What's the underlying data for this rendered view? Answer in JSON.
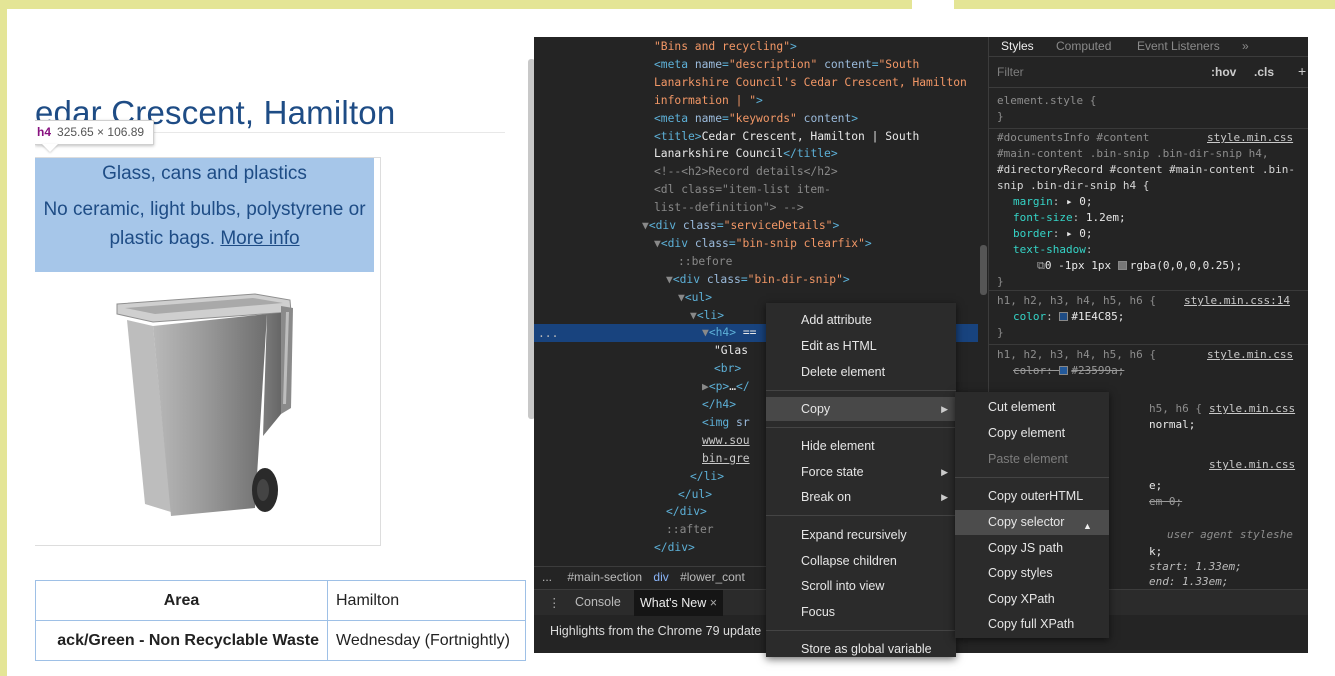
{
  "webpage": {
    "title": "edar Crescent, Hamilton",
    "tooltip": {
      "tag": "h4",
      "size": "325.65 × 106.89"
    },
    "bin_heading": "Glass, cans and plastics",
    "bin_note": "No ceramic, light bulbs, polystyrene or plastic bags.",
    "more_info": "More info",
    "table": [
      {
        "label": "Area",
        "value": "Hamilton"
      },
      {
        "label": "ack/Green - Non Recyclable Waste",
        "value": "Wednesday (Fortnightly)"
      }
    ]
  },
  "devtools": {
    "elements_lines": [
      {
        "indent": 0,
        "parts": [
          [
            "val",
            "\"Bins and recycling\""
          ],
          [
            "tag",
            ">"
          ]
        ]
      },
      {
        "indent": 0,
        "parts": [
          [
            "tag",
            "<meta "
          ],
          [
            "attr",
            "name"
          ],
          [
            "tag",
            "="
          ],
          [
            "val",
            "\"description\""
          ],
          [
            "attr",
            " content"
          ],
          [
            "tag",
            "="
          ],
          [
            "val",
            "\"South"
          ]
        ]
      },
      {
        "indent": 0,
        "parts": [
          [
            "val",
            "Lanarkshire Council's Cedar Crescent, Hamilton"
          ]
        ]
      },
      {
        "indent": 0,
        "parts": [
          [
            "val",
            "information | \""
          ],
          [
            "tag",
            ">"
          ]
        ]
      },
      {
        "indent": 0,
        "parts": [
          [
            "tag",
            "<meta "
          ],
          [
            "attr",
            "name"
          ],
          [
            "tag",
            "="
          ],
          [
            "val",
            "\"keywords\""
          ],
          [
            "attr",
            " content"
          ],
          [
            "tag",
            ">"
          ]
        ]
      },
      {
        "indent": 0,
        "parts": [
          [
            "tag",
            "<title>"
          ],
          [
            "txt",
            "Cedar Crescent, Hamilton | South"
          ]
        ]
      },
      {
        "indent": 0,
        "parts": [
          [
            "txt",
            "Lanarkshire Council"
          ],
          [
            "tag",
            "</title>"
          ]
        ]
      },
      {
        "indent": 0,
        "parts": [
          [
            "com",
            "<!--<h2>Record details</h2>"
          ]
        ]
      },
      {
        "indent": 0,
        "parts": [
          [
            "com",
            "               <dl class=\"item-list item-"
          ]
        ]
      },
      {
        "indent": 0,
        "parts": [
          [
            "com",
            "list--definition\"> -->"
          ]
        ]
      },
      {
        "indent": -1,
        "parts": [
          [
            "com",
            "▼"
          ],
          [
            "tag",
            "<div "
          ],
          [
            "attr",
            "class"
          ],
          [
            "tag",
            "="
          ],
          [
            "val",
            "\"serviceDetails\""
          ],
          [
            "tag",
            ">"
          ]
        ]
      },
      {
        "indent": 0,
        "parts": [
          [
            "com",
            "▼"
          ],
          [
            "tag",
            "<div "
          ],
          [
            "attr",
            "class"
          ],
          [
            "tag",
            "="
          ],
          [
            "val",
            "\"bin-snip clearfix\""
          ],
          [
            "tag",
            ">"
          ]
        ]
      },
      {
        "indent": 2,
        "parts": [
          [
            "com",
            "::before"
          ]
        ]
      },
      {
        "indent": 1,
        "parts": [
          [
            "com",
            "▼"
          ],
          [
            "tag",
            "<div "
          ],
          [
            "attr",
            "class"
          ],
          [
            "tag",
            "="
          ],
          [
            "val",
            "\"bin-dir-snip\""
          ],
          [
            "tag",
            ">"
          ]
        ]
      },
      {
        "indent": 2,
        "parts": [
          [
            "com",
            "▼"
          ],
          [
            "tag",
            "<ul>"
          ]
        ]
      },
      {
        "indent": 3,
        "parts": [
          [
            "com",
            "▼"
          ],
          [
            "tag",
            "<li>"
          ]
        ]
      },
      {
        "indent": 4,
        "parts": [
          [
            "com",
            "▼"
          ],
          [
            "tag",
            "<h4>"
          ],
          [
            "txt",
            " =="
          ]
        ]
      },
      {
        "indent": 5,
        "parts": [
          [
            "txt",
            "\"Glas"
          ]
        ]
      },
      {
        "indent": 5,
        "parts": [
          [
            "tag",
            "<br>"
          ]
        ]
      },
      {
        "indent": 4,
        "parts": [
          [
            "com",
            "▶"
          ],
          [
            "tag",
            "<p>"
          ],
          [
            "txt",
            "…"
          ],
          [
            "tag",
            "</"
          ]
        ]
      },
      {
        "indent": 4,
        "parts": [
          [
            "tag",
            "</h4>"
          ]
        ]
      },
      {
        "indent": 4,
        "parts": [
          [
            "tag",
            "<img "
          ],
          [
            "attr",
            "sr"
          ]
        ]
      },
      {
        "indent": 4,
        "parts": [
          [
            "link",
            "www.sou"
          ]
        ]
      },
      {
        "indent": 4,
        "parts": [
          [
            "link",
            "bin-gre"
          ]
        ]
      },
      {
        "indent": 3,
        "parts": [
          [
            "tag",
            "</li>"
          ]
        ]
      },
      {
        "indent": 2,
        "parts": [
          [
            "tag",
            "</ul>"
          ]
        ]
      },
      {
        "indent": 1,
        "parts": [
          [
            "tag",
            "</div>"
          ]
        ]
      },
      {
        "indent": 1,
        "parts": [
          [
            "com",
            "::after"
          ]
        ]
      },
      {
        "indent": 0,
        "parts": [
          [
            "tag",
            "</div>"
          ]
        ]
      }
    ],
    "breadcrumb": {
      "ellipsis": "...",
      "main_section": "#main-section",
      "div": "div",
      "lower": "#lower_cont"
    },
    "drawer": {
      "console": "Console",
      "whats_new": "What's New",
      "close": "×",
      "highlights": "Highlights from the Chrome 79 update"
    },
    "styles": {
      "tabs": [
        "Styles",
        "Computed",
        "Event Listeners",
        "»"
      ],
      "filter_placeholder": "Filter",
      "hov": ":hov",
      "cls": ".cls",
      "plus": "+",
      "element_style": "element.style {",
      "brace_close": "}",
      "rule1_sel1": "#documentsInfo #content",
      "rule1_link": "style.min.css",
      "rule1_sel2": "#main-content .bin-snip .bin-dir-snip h4,",
      "rule1_sel3": "#directoryRecord #content #main-content .bin-",
      "rule1_sel4": "snip .bin-dir-snip h4 {",
      "margin": [
        "margin",
        "▸ 0;"
      ],
      "font_size": [
        "font-size",
        "1.2em;"
      ],
      "border": [
        "border",
        "▸ 0;"
      ],
      "text_shadow": [
        "text-shadow",
        ""
      ],
      "text_shadow_val": "0 -1px 1px ",
      "text_shadow_color": "rgba(0,0,0,0.25);",
      "rule2_sel": "h1, h2, h3, h4, h5, h6 {",
      "rule2_link": "style.min.css:14",
      "rule2_color": [
        "color",
        "#1E4C85;"
      ],
      "rule3_sel": "h1, h2, h3, h4, h5, h6 {",
      "rule3_link": "style.min.css",
      "rule3_color": [
        "color",
        "#23599a;"
      ],
      "rule4_sel": "h5, h6 {",
      "rule4_link": "style.min.css",
      "rule4_val": "normal;",
      "rule5_link": "style.min.css",
      "rule5_a": "e;",
      "rule5_b": "em 0;",
      "ua": "user agent styleshe",
      "ua_semi": "k;",
      "ua_start": "start: 1.33em;",
      "ua_end": "end: 1.33em;",
      "colors": {
        "h1color": "#1E4C85",
        "h1color_old": "#23599a"
      }
    },
    "context_menu": {
      "items": [
        "Add attribute",
        "Edit as HTML",
        "Delete element",
        "Copy",
        "Hide element",
        "Force state",
        "Break on",
        "Expand recursively",
        "Collapse children",
        "Scroll into view",
        "Focus",
        "Store as global variable"
      ],
      "submenu": [
        "Cut element",
        "Copy element",
        "Paste element",
        "Copy outerHTML",
        "Copy selector",
        "Copy JS path",
        "Copy styles",
        "Copy XPath",
        "Copy full XPath"
      ]
    }
  }
}
